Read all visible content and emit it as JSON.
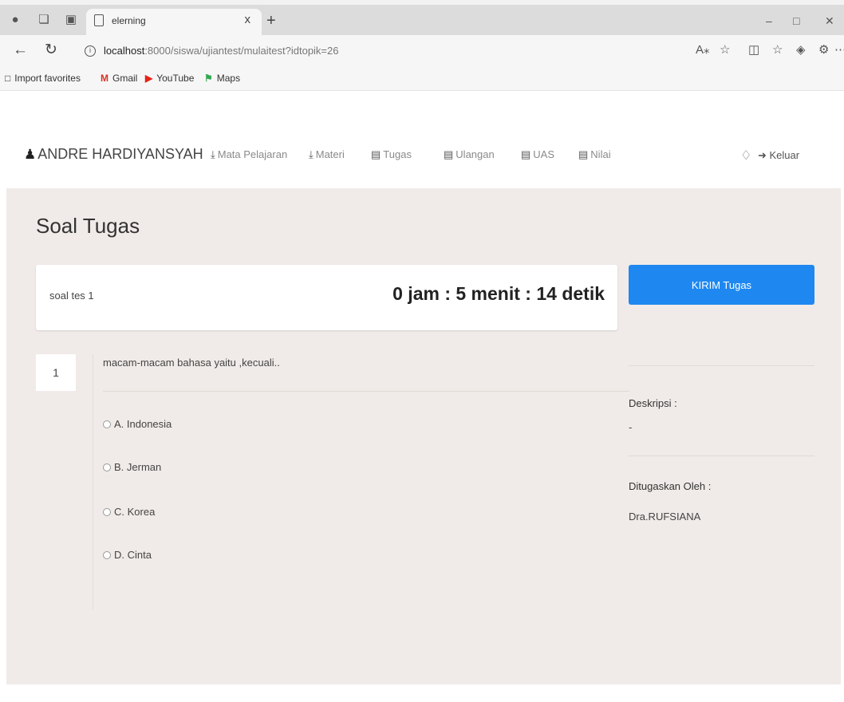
{
  "browser": {
    "tab_title": "elerning",
    "tab_close": "x",
    "new_tab": "+",
    "url_host": "localhost",
    "url_rest": ":8000/siswa/ujiantest/mulaitest?idtopik=26",
    "favorites": [
      {
        "label": "Import favorites",
        "icon": "folder-icon"
      },
      {
        "label": "Gmail",
        "icon": "gmail-icon",
        "color": "#d93025"
      },
      {
        "label": "YouTube",
        "icon": "youtube-icon",
        "color": "#e62117"
      },
      {
        "label": "Maps",
        "icon": "maps-icon",
        "color": "#34a853"
      }
    ]
  },
  "nav": {
    "user_name": "ANDRE HARDIYANSYAH",
    "items": [
      "Mata Pelajaran",
      "Materi",
      "Tugas",
      "Ulangan",
      "UAS",
      "Nilai"
    ],
    "logout": "Keluar"
  },
  "page": {
    "title": "Soal Tugas",
    "quiz_name": "soal tes 1",
    "timer": "0 jam : 5 menit : 14 detik",
    "submit_label": "KIRIM Tugas",
    "accent": "#1e88f0"
  },
  "question": {
    "number": "1",
    "text": "macam-macam bahasa yaitu ,kecuali..",
    "options": [
      "A. Indonesia",
      "B. Jerman",
      "C. Korea",
      "D. Cinta"
    ]
  },
  "sidebar": {
    "desc_label": "Deskripsi :",
    "desc_value": "-",
    "assigned_label": "Ditugaskan Oleh :",
    "assigned_value": "Dra.RUFSIANA"
  }
}
